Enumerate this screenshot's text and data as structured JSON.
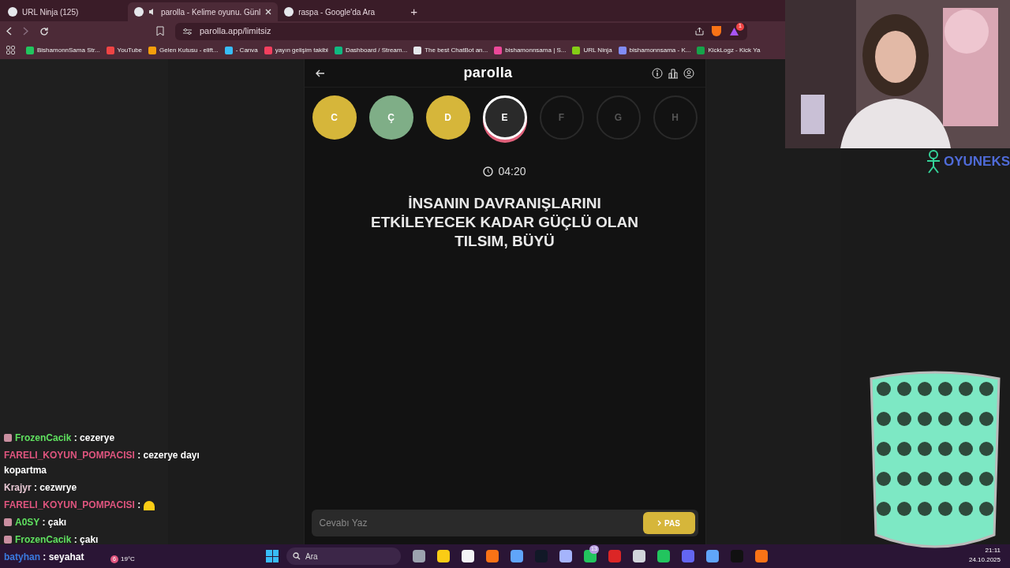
{
  "browser": {
    "tabs": [
      {
        "title": "URL Ninja (125)",
        "selected": false,
        "audio": false
      },
      {
        "title": "parolla - Kelime oyunu. Günl",
        "selected": true,
        "audio": true
      },
      {
        "title": "raspa - Google'da Ara",
        "selected": false,
        "audio": false
      }
    ],
    "new_tab": "+",
    "url": "parolla.app/limitsiz",
    "extension_badge": "1",
    "bookmarks": [
      "BishamonnSama Str...",
      "YouTube",
      "Gelen Kutusu - elift...",
      "- Canva",
      "yayın gelişim takibi",
      "Dashboard / Stream...",
      "The best ChatBot an...",
      "bishamonnsama | S...",
      "URL Ninja",
      "bishamonnsama - K...",
      "KickLogz - Kick Ya"
    ]
  },
  "app": {
    "title": "parolla",
    "letters": [
      {
        "letter": "C",
        "kind": "passed"
      },
      {
        "letter": "Ç",
        "kind": "correct"
      },
      {
        "letter": "D",
        "kind": "passed"
      },
      {
        "letter": "E",
        "kind": "current"
      },
      {
        "letter": "F",
        "kind": "pending"
      },
      {
        "letter": "G",
        "kind": "pending"
      },
      {
        "letter": "H",
        "kind": "pending"
      }
    ],
    "timer": "04:20",
    "question": "İNSANIN DAVRANIŞLARINI ETKİLEYECEK KADAR GÜÇLÜ OLAN TILSIM, BÜYÜ",
    "answer_placeholder": "Cevabı Yaz",
    "pass_button": "PAS"
  },
  "overlay": {
    "logo": "OYUNEKS"
  },
  "chat": [
    {
      "user": "FrozenCacik",
      "color": "#5fe05f",
      "badge": true,
      "text": ": cezerye"
    },
    {
      "user": "FARELI_KOYUN_POMPACISI",
      "color": "#e0557f",
      "badge": false,
      "text": ": cezerye dayı kopartma"
    },
    {
      "user": "Krajyr",
      "color": "#e8c8d4",
      "badge": false,
      "text": ": cezwrye"
    },
    {
      "user": "FARELI_KOYUN_POMPACISI",
      "color": "#e0557f",
      "badge": false,
      "kind": "emote",
      "text": ":"
    },
    {
      "user": "A0SY",
      "color": "#5fe05f",
      "badge": true,
      "text": ": çakı"
    },
    {
      "user": "FrozenCacik",
      "color": "#5fe05f",
      "badge": true,
      "text": ": çakı"
    },
    {
      "user": "batyhan",
      "color": "#3a7be0",
      "badge": false,
      "text": ": seyahat"
    }
  ],
  "taskbar": {
    "weather": "19°C",
    "weather_badge": "6",
    "search": "Ara",
    "xbox_badge": "13",
    "time": "21:11",
    "date": "24.10.2025"
  }
}
